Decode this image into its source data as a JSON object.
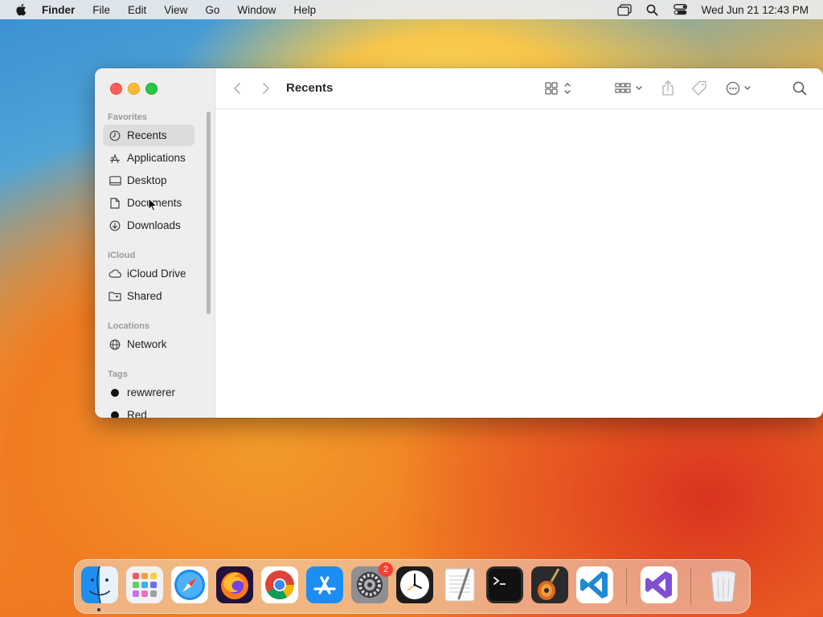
{
  "menubar": {
    "app_name": "Finder",
    "menus": [
      "File",
      "Edit",
      "View",
      "Go",
      "Window",
      "Help"
    ],
    "clock": "Wed Jun 21  12:43 PM"
  },
  "window": {
    "title": "Recents",
    "sidebar": {
      "sections": {
        "favorites": "Favorites",
        "icloud": "iCloud",
        "locations": "Locations",
        "tags": "Tags"
      },
      "favorites": [
        {
          "label": "Recents",
          "icon": "clock-icon",
          "selected": true
        },
        {
          "label": "Applications",
          "icon": "applications-icon"
        },
        {
          "label": "Desktop",
          "icon": "desktop-icon"
        },
        {
          "label": "Documents",
          "icon": "document-icon"
        },
        {
          "label": "Downloads",
          "icon": "download-icon"
        }
      ],
      "icloud": [
        {
          "label": "iCloud Drive",
          "icon": "cloud-icon"
        },
        {
          "label": "Shared",
          "icon": "shared-folder-icon"
        }
      ],
      "locations": [
        {
          "label": "Network",
          "icon": "globe-icon"
        }
      ],
      "tags": [
        {
          "label": "rewwrerer",
          "color": "#111111"
        },
        {
          "label": "Red",
          "color": "#111111"
        }
      ]
    }
  },
  "dock": {
    "apps": [
      "finder-icon",
      "launchpad-icon",
      "safari-icon",
      "firefox-icon",
      "chrome-icon",
      "app-store-icon",
      "system-settings-icon",
      "clock-app-icon",
      "textedit-icon",
      "terminal-icon",
      "garageband-icon",
      "vscode-icon",
      "visual-studio-icon",
      "trash-icon"
    ],
    "settings_badge": "2"
  },
  "colors": {
    "close": "#ff5f57",
    "minimize": "#febc2e",
    "maximize": "#28c840"
  }
}
